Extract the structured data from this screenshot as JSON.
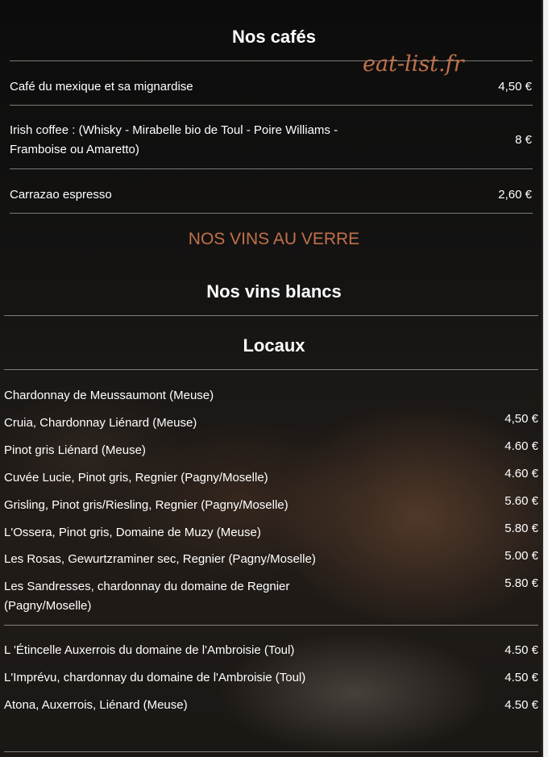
{
  "watermark": "eat-list.fr",
  "cafes": {
    "title": "Nos cafés",
    "items": [
      {
        "name": "Café du mexique et sa mignardise",
        "price": "4,50 €"
      },
      {
        "name_line1": "Irish coffee : (Whisky -  Mirabelle bio de Toul - Poire Williams -",
        "name_line2": "Framboise ou Amaretto)",
        "price": "8 €"
      },
      {
        "name": "Carrazao espresso",
        "price": "2,60 €"
      }
    ]
  },
  "vins_au_verre": "NOS VINS AU VERRE",
  "vins_blancs": {
    "title": "Nos vins blancs",
    "subtitle": "Locaux",
    "items": [
      {
        "name": "Chardonnay de Meussaumont (Meuse)",
        "price": ""
      },
      {
        "name": "Cruia, Chardonnay Liénard (Meuse)",
        "price": "4,50 €"
      },
      {
        "name": "Pinot gris Liénard (Meuse)",
        "price": "4.60 €"
      },
      {
        "name": "Cuvée Lucie, Pinot gris, Regnier (Pagny/Moselle)",
        "price": "4.60 €"
      },
      {
        "name": "Grisling, Pinot gris/Riesling, Regnier (Pagny/Moselle)",
        "price": "5.60 €"
      },
      {
        "name": "L'Ossera, Pinot gris, Domaine de Muzy (Meuse)",
        "price": "5.80 €"
      },
      {
        "name": "Les Rosas, Gewurtzraminer sec, Regnier (Pagny/Moselle)",
        "price": "5.00 €"
      },
      {
        "name_line1": "Les Sandresses, chardonnay du domaine de Regnier",
        "name_line2": "(Pagny/Moselle)",
        "price": "5.80 €"
      }
    ],
    "items2": [
      {
        "name": "L 'Étincelle Auxerrois du domaine de l'Ambroisie (Toul)",
        "price": "4.50 €"
      },
      {
        "name": "L'Imprévu, chardonnay du domaine de l'Ambroisie (Toul)",
        "price": "4.50 €"
      },
      {
        "name": "Atona, Auxerrois, Liénard (Meuse)",
        "price": "4.50 €"
      }
    ]
  },
  "colors": {
    "accent": "#c0714a",
    "text": "#ffffff"
  }
}
